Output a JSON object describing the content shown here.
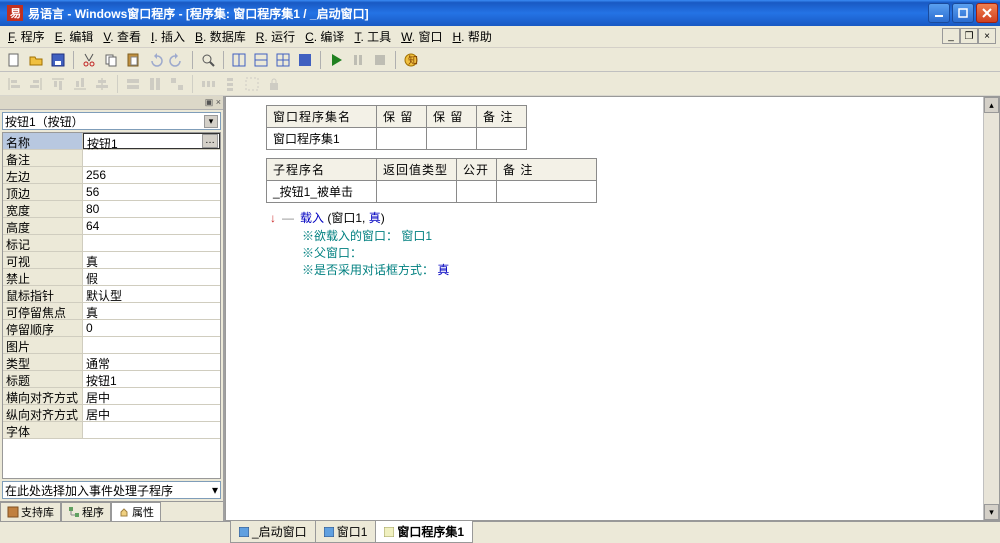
{
  "titlebar": {
    "app": "易语言",
    "doc": "Windows窗口程序",
    "sub": "[程序集: 窗口程序集1 / _启动窗口]"
  },
  "menu": {
    "items": [
      {
        "key": "F",
        "label": "程序"
      },
      {
        "key": "E",
        "label": "编辑"
      },
      {
        "key": "V",
        "label": "查看"
      },
      {
        "key": "I",
        "label": "插入"
      },
      {
        "key": "B",
        "label": "数据库"
      },
      {
        "key": "R",
        "label": "运行"
      },
      {
        "key": "C",
        "label": "编译"
      },
      {
        "key": "T",
        "label": "工具"
      },
      {
        "key": "W",
        "label": "窗口"
      },
      {
        "key": "H",
        "label": "帮助"
      }
    ]
  },
  "props": {
    "combo": "按钮1（按钮）",
    "rows": [
      {
        "k": "名称",
        "v": "按钮1",
        "sel": true,
        "dots": true
      },
      {
        "k": "备注",
        "v": ""
      },
      {
        "k": "左边",
        "v": "256"
      },
      {
        "k": "顶边",
        "v": "56"
      },
      {
        "k": "宽度",
        "v": "80"
      },
      {
        "k": "高度",
        "v": "64"
      },
      {
        "k": "标记",
        "v": ""
      },
      {
        "k": "可视",
        "v": "真"
      },
      {
        "k": "禁止",
        "v": "假"
      },
      {
        "k": "鼠标指针",
        "v": "默认型"
      },
      {
        "k": "可停留焦点",
        "v": "真"
      },
      {
        "k": "  停留顺序",
        "v": "0"
      },
      {
        "k": "图片",
        "v": ""
      },
      {
        "k": "类型",
        "v": "通常"
      },
      {
        "k": "标题",
        "v": "按钮1"
      },
      {
        "k": "横向对齐方式",
        "v": "居中"
      },
      {
        "k": "纵向对齐方式",
        "v": "居中"
      },
      {
        "k": "字体",
        "v": ""
      }
    ],
    "event_placeholder": "在此处选择加入事件处理子程序",
    "tabs": [
      {
        "label": "支持库",
        "icon": "book"
      },
      {
        "label": "程序",
        "icon": "tree"
      },
      {
        "label": "属性",
        "icon": "hand",
        "active": true
      }
    ]
  },
  "editor": {
    "table1": {
      "headers": [
        "窗口程序集名",
        "保 留",
        "保 留",
        "备 注"
      ],
      "rows": [
        [
          "窗口程序集1",
          "",
          "",
          ""
        ]
      ]
    },
    "table2": {
      "headers": [
        "子程序名",
        "返回值类型",
        "公开",
        "备 注"
      ],
      "rows": [
        [
          "_按钮1_被单击",
          "",
          "",
          ""
        ]
      ]
    },
    "code": {
      "call": "载入",
      "args": [
        "窗口1",
        ", ",
        "真"
      ],
      "comments": [
        "※欲载入的窗口： 窗口1",
        "※父窗口：",
        "※是否采用对话框方式： "
      ],
      "comment_tail": "真"
    }
  },
  "bottom_tabs": [
    {
      "label": "_启动窗口"
    },
    {
      "label": "窗口1"
    },
    {
      "label": "窗口程序集1",
      "active": true
    }
  ]
}
